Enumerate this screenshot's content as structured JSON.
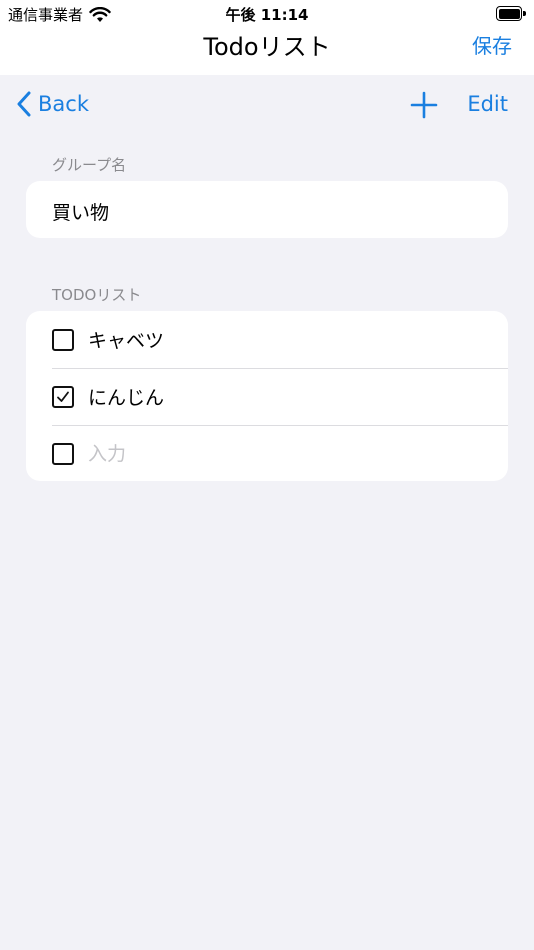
{
  "status_bar": {
    "carrier": "通信事業者",
    "time": "午後 11:14"
  },
  "header": {
    "title": "Todoリスト",
    "save_label": "保存"
  },
  "nav": {
    "back_label": "Back",
    "edit_label": "Edit"
  },
  "group_section": {
    "header": "グループ名",
    "value": "買い物"
  },
  "todo_section": {
    "header": "TODOリスト",
    "items": [
      {
        "label": "キャベツ",
        "checked": false
      },
      {
        "label": "にんじん",
        "checked": true
      }
    ],
    "new_item_placeholder": "入力"
  },
  "colors": {
    "accent": "#1a7fe0",
    "background": "#f2f2f7",
    "card": "#ffffff",
    "secondary_text": "#8a8a8e",
    "placeholder": "#c4c4c8"
  },
  "icons": {
    "wifi": "wifi-icon",
    "battery": "battery-icon",
    "back": "chevron-left-icon",
    "add": "plus-icon",
    "checkbox": "checkbox-icon",
    "checkmark": "checkmark-icon"
  }
}
